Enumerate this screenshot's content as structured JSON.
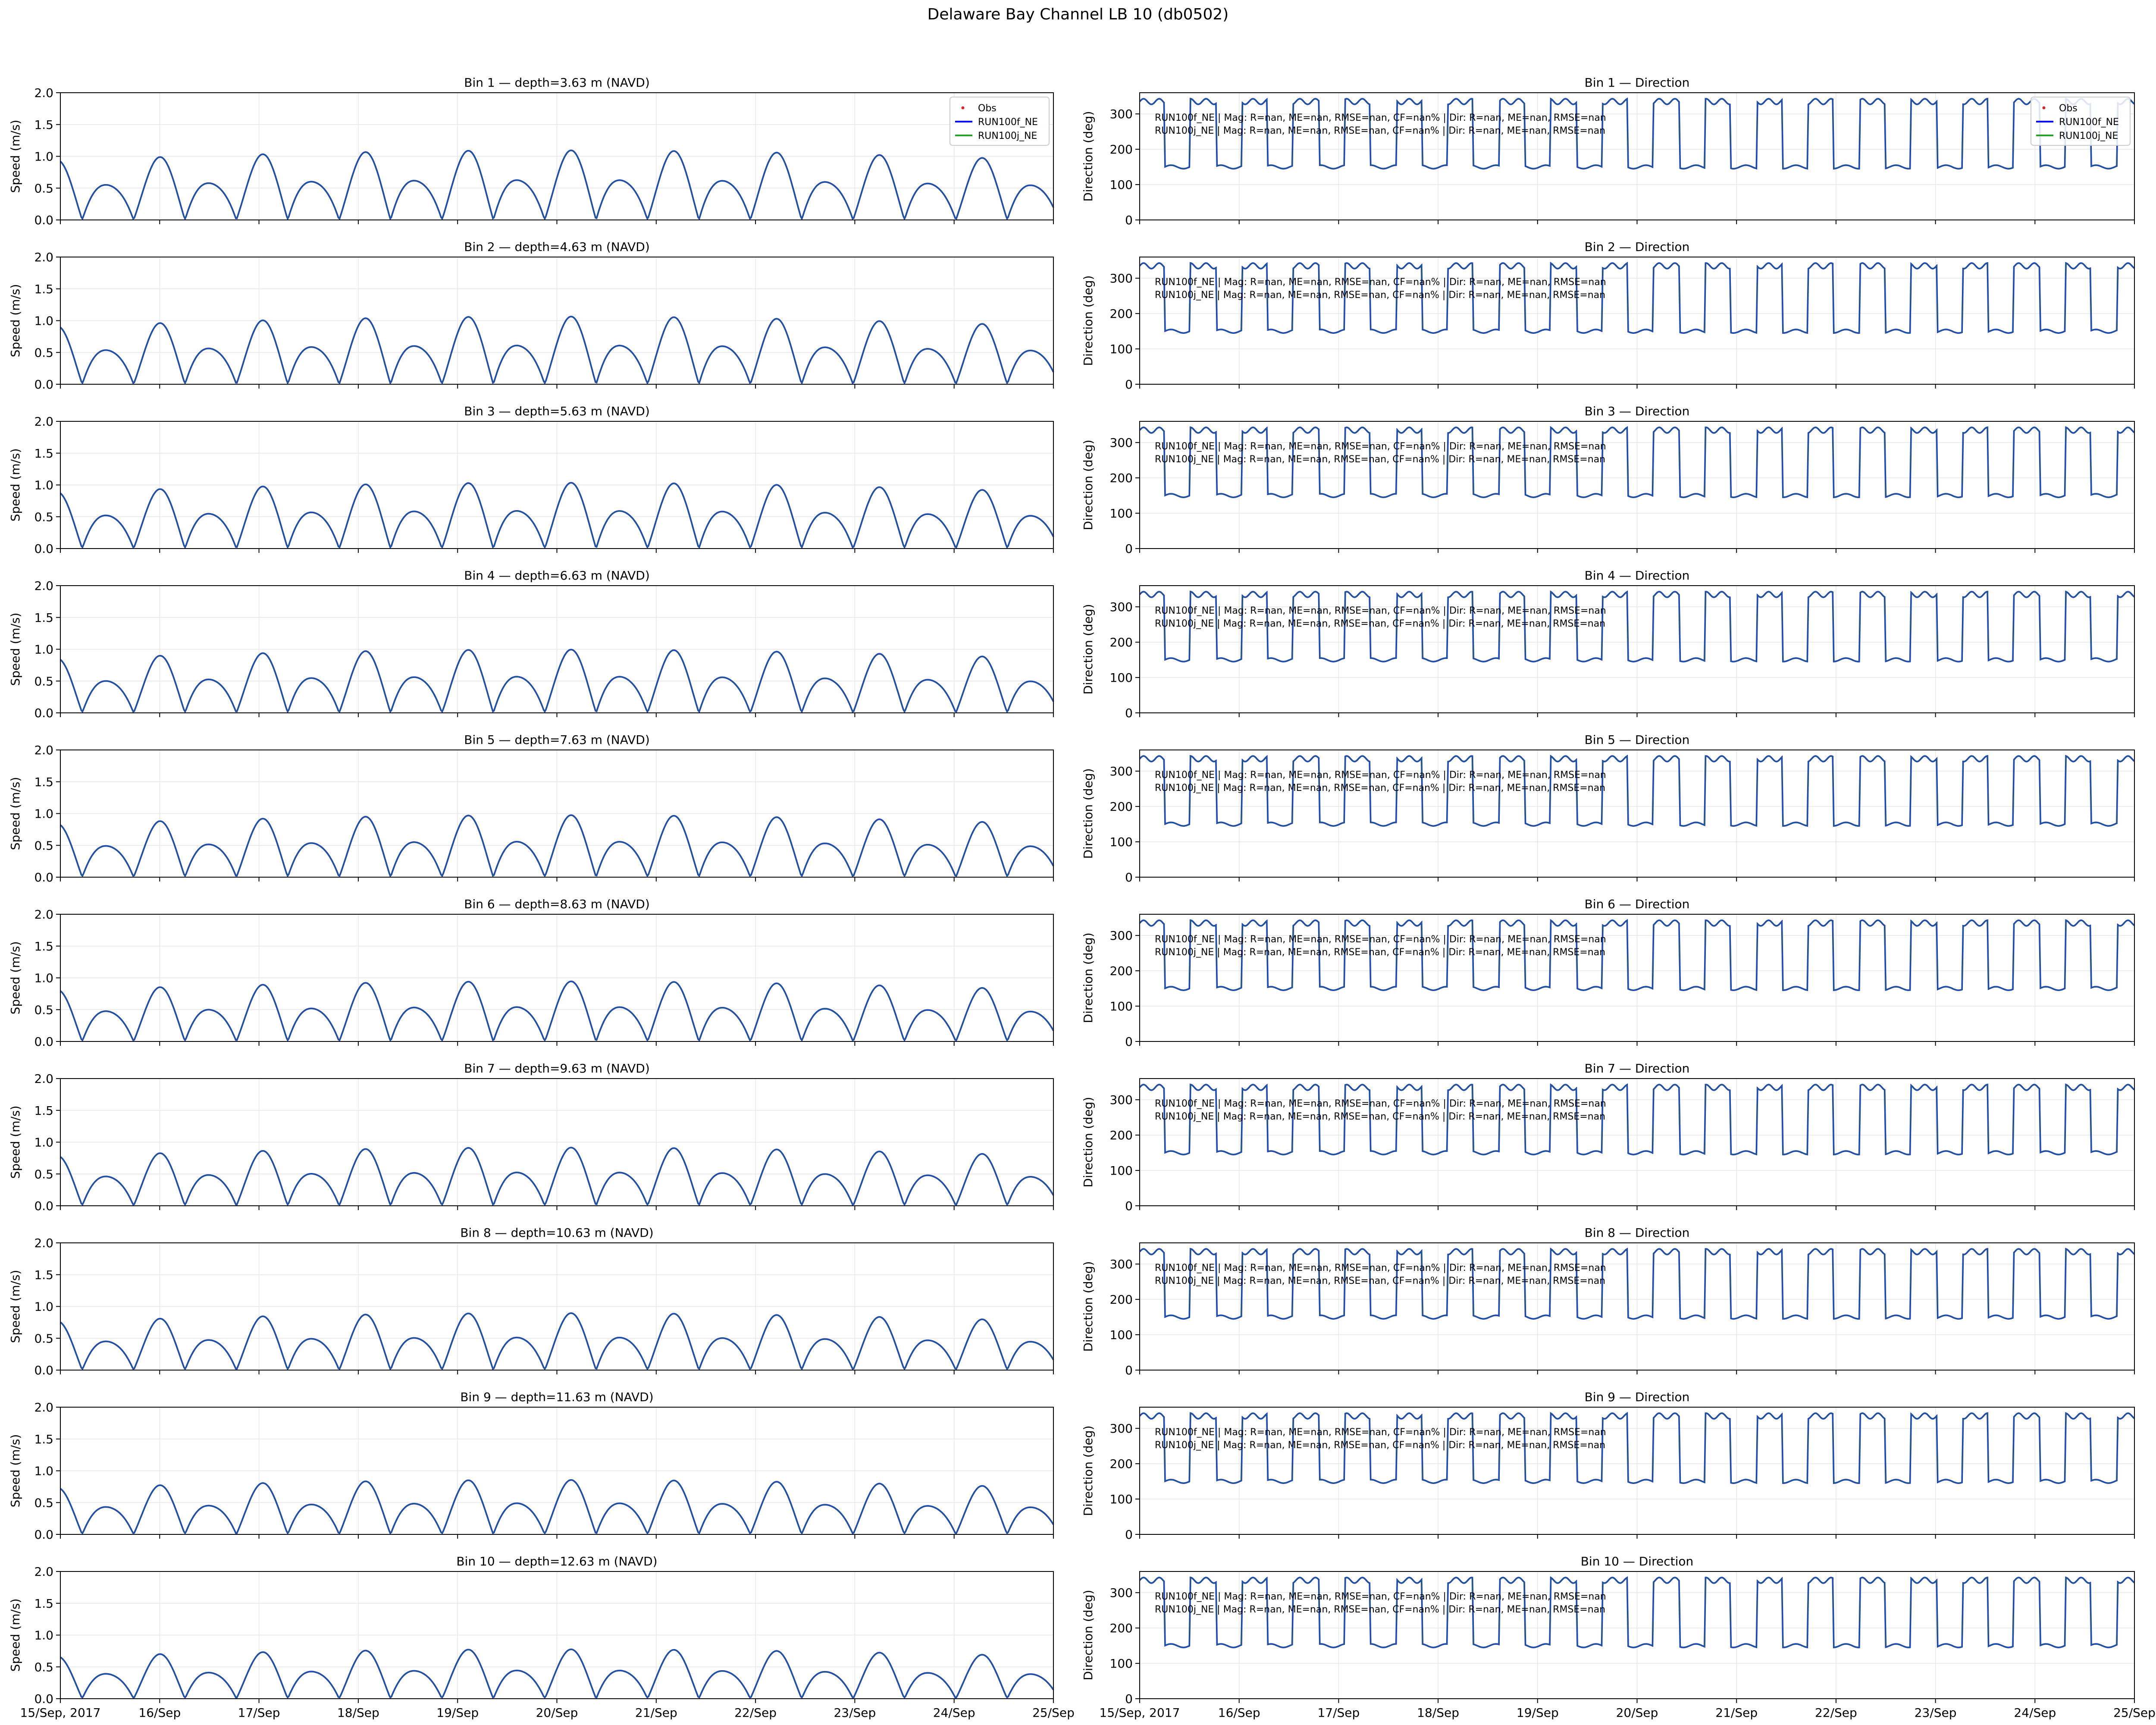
{
  "figure": {
    "title": "Delaware Bay Channel LB 10 (db0502)",
    "x_tick_labels": [
      "15/Sep, 2017",
      "16/Sep",
      "17/Sep",
      "18/Sep",
      "19/Sep",
      "20/Sep",
      "21/Sep",
      "22/Sep",
      "23/Sep",
      "24/Sep",
      "25/Sep"
    ]
  },
  "legend": {
    "entries": [
      {
        "name": "Obs",
        "color": "#d62728",
        "marker": "dot"
      },
      {
        "name": "RUN100f_NE",
        "color": "#0000ff",
        "marker": "line"
      },
      {
        "name": "RUN100j_NE",
        "color": "#2ca02c",
        "marker": "line"
      }
    ]
  },
  "colors": {
    "run100f": "#0000ff",
    "run100j": "#2ca02c",
    "grid": "#e6e6e6",
    "axes": "#000000"
  },
  "stats_lines": [
    "RUN100f_NE | Mag: R=nan, ME=nan, RMSE=nan, CF=nan% | Dir: R=nan, ME=nan, RMSE=nan",
    "RUN100j_NE | Mag: R=nan, ME=nan, RMSE=nan, CF=nan% | Dir: R=nan, ME=nan, RMSE=nan"
  ],
  "chart_data": {
    "type": "line",
    "x_range": [
      "2017-09-15",
      "2017-09-25"
    ],
    "x_ticks": [
      "2017-09-15",
      "2017-09-16",
      "2017-09-17",
      "2017-09-18",
      "2017-09-19",
      "2017-09-20",
      "2017-09-21",
      "2017-09-22",
      "2017-09-23",
      "2017-09-24",
      "2017-09-25"
    ],
    "grid": true,
    "legend_placement": "upper right (Bin 1 panels only)",
    "speed_panel": {
      "ylabel": "Speed (m/s)",
      "ylim": [
        0,
        2
      ],
      "yticks": [
        0.0,
        0.5,
        1.0,
        1.5,
        2.0
      ],
      "ytick_labels": [
        "0.0",
        "0.5",
        "1.0",
        "1.5",
        "2.0"
      ]
    },
    "direction_panel": {
      "ylabel": "Direction (deg)",
      "ylim": [
        0,
        360
      ],
      "yticks": [
        0,
        100,
        200,
        300
      ],
      "ytick_labels": [
        "0",
        "100",
        "200",
        "300"
      ]
    },
    "series_names": [
      "Obs",
      "RUN100f_NE",
      "RUN100j_NE"
    ],
    "bins": [
      {
        "bin": 1,
        "speed_title": "Bin 1 — depth=3.63 m (NAVD)",
        "direction_title": "Bin 1 — Direction",
        "depth_m": 3.63,
        "peak_speed_m_s": 1.1
      },
      {
        "bin": 2,
        "speed_title": "Bin 2 — depth=4.63 m (NAVD)",
        "direction_title": "Bin 2 — Direction",
        "depth_m": 4.63,
        "peak_speed_m_s": 1.07
      },
      {
        "bin": 3,
        "speed_title": "Bin 3 — depth=5.63 m (NAVD)",
        "direction_title": "Bin 3 — Direction",
        "depth_m": 5.63,
        "peak_speed_m_s": 1.04
      },
      {
        "bin": 4,
        "speed_title": "Bin 4 — depth=6.63 m (NAVD)",
        "direction_title": "Bin 4 — Direction",
        "depth_m": 6.63,
        "peak_speed_m_s": 1.0
      },
      {
        "bin": 5,
        "speed_title": "Bin 5 — depth=7.63 m (NAVD)",
        "direction_title": "Bin 5 — Direction",
        "depth_m": 7.63,
        "peak_speed_m_s": 0.98
      },
      {
        "bin": 6,
        "speed_title": "Bin 6 — depth=8.63 m (NAVD)",
        "direction_title": "Bin 6 — Direction",
        "depth_m": 8.63,
        "peak_speed_m_s": 0.95
      },
      {
        "bin": 7,
        "speed_title": "Bin 7 — depth=9.63 m (NAVD)",
        "direction_title": "Bin 7 — Direction",
        "depth_m": 9.63,
        "peak_speed_m_s": 0.92
      },
      {
        "bin": 8,
        "speed_title": "Bin 8 — depth=10.63 m (NAVD)",
        "direction_title": "Bin 8 — Direction",
        "depth_m": 10.63,
        "peak_speed_m_s": 0.9
      },
      {
        "bin": 9,
        "speed_title": "Bin 9 — depth=11.63 m (NAVD)",
        "direction_title": "Bin 9 — Direction",
        "depth_m": 11.63,
        "peak_speed_m_s": 0.86
      },
      {
        "bin": 10,
        "speed_title": "Bin 10 — depth=12.63 m (NAVD)",
        "direction_title": "Bin 10 — Direction",
        "depth_m": 12.63,
        "peak_speed_m_s": 0.78
      }
    ],
    "tidal_period_hours": 12.42,
    "flood_direction_deg": 335,
    "ebb_direction_deg": 150
  }
}
